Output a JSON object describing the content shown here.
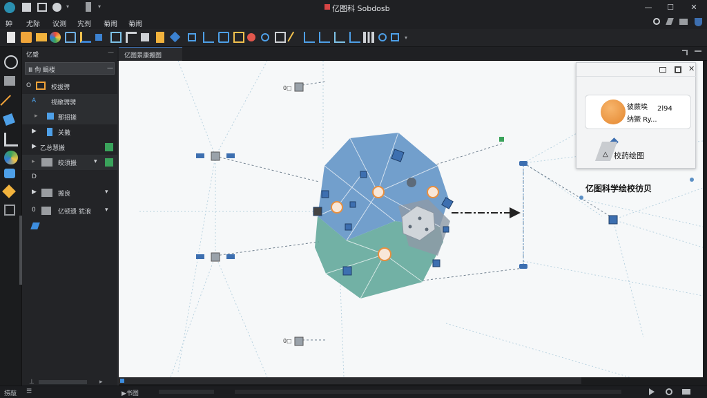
{
  "app": {
    "title": "亿图科 Sobdosb",
    "colors": {
      "accent": "#4a7fb3",
      "node_blue": "#5b8fc4",
      "node_green": "#5aa597",
      "orange": "#e88f3f",
      "panel": "#232427",
      "canvas": "#f6f8f9"
    }
  },
  "titlebar": {
    "min_glyph": "—",
    "max_glyph": "☐",
    "close_glyph": "✕"
  },
  "menu": {
    "items": [
      "妕",
      "尤际",
      "议测",
      "宄刭",
      "菊闹",
      "菊闹"
    ],
    "right_icons": [
      "search-icon",
      "pin-icon",
      "panel-icon",
      "shield-icon"
    ]
  },
  "toolbar": {
    "icons": [
      "new-file-icon",
      "open-icon",
      "folder-icon",
      "color-wheel-icon",
      "shape-triangle-icon",
      "connector-icon",
      "select-icon",
      "connector-tool-icon",
      "align-icon",
      "group-icon",
      "book-icon",
      "diamond-icon",
      "node-icon",
      "node-icon-2",
      "node-icon-3",
      "node-icon-4",
      "paint-icon",
      "zoom-icon",
      "crop-icon",
      "pen-icon",
      "chart-icon",
      "chart-icon-2",
      "chart-icon-3",
      "bars-icon",
      "zoom-icon-2",
      "more-icon"
    ]
  },
  "left_panel": {
    "title": "亿蹙",
    "filter_label": "Ⅲ 佝 蝎楼",
    "filter_glyph": "—",
    "rows": [
      {
        "prefix": "O",
        "label": "校拔骋"
      },
      {
        "prefix": "A",
        "label": "视敞骋骋"
      },
      {
        "prefix": "▸",
        "label": "那招搓"
      },
      {
        "prefix": "▶",
        "label": "关撒"
      },
      {
        "prefix": "▶",
        "label": "乙总慧搬"
      },
      {
        "prefix": "▸",
        "label": "皎须搬"
      },
      {
        "prefix": "D",
        "label": ""
      },
      {
        "prefix": "▶",
        "label": "搬良"
      },
      {
        "prefix": "0",
        "label": "亿顿遗 犹浪"
      }
    ],
    "bottom_left": "⊥",
    "bottom_right": "▸"
  },
  "tab": {
    "label": "亿图景康搬图"
  },
  "canvas": {
    "nodes": [
      {
        "label": "0□"
      },
      {
        "label": "0□"
      }
    ],
    "annotation": "亿图科学绘校彷贝",
    "popup": {
      "card_line1": "彼蕨埃",
      "card_value": "2l94",
      "card_line2": "纳獗 Ry...",
      "footer_label": "校药绘图",
      "controls": [
        "minimize-icon",
        "maximize-icon",
        "close-icon"
      ]
    }
  },
  "statusbar": {
    "left": "捞敲",
    "left2": "☰",
    "mid": "▶书图",
    "right_icons": [
      "play-icon",
      "settings-icon",
      "tray-icon"
    ]
  }
}
